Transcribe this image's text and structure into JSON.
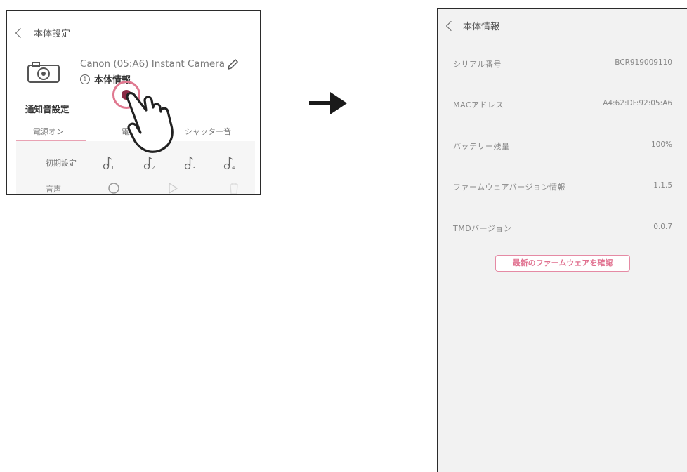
{
  "left_screen": {
    "header": {
      "title": "本体設定"
    },
    "device": {
      "name": "Canon (05:A6) Instant Camera",
      "info_label": "本体情報"
    },
    "notification": {
      "title": "通知音設定"
    },
    "tabs": [
      {
        "label": "電源オン"
      },
      {
        "label": "電源オ"
      },
      {
        "label": "シャッター音"
      }
    ],
    "sound_row": {
      "label": "初期設定",
      "notes": [
        "1",
        "2",
        "3",
        "4"
      ]
    },
    "voice_row": {
      "label": "音声"
    }
  },
  "right_screen": {
    "header": {
      "title": "本体情報"
    },
    "items": [
      {
        "label": "シリアル番号",
        "value": "BCR919009110"
      },
      {
        "label": "MACアドレス",
        "value": "A4:62:DF:92:05:A6"
      },
      {
        "label": "バッテリー残量",
        "value": "100%"
      },
      {
        "label": "ファームウェアバージョン情報",
        "value": "1.1.5"
      },
      {
        "label": "TMDバージョン",
        "value": "0.0.7"
      }
    ],
    "check_button": "最新のファームウェアを確認"
  },
  "colors": {
    "accent": "#e0708f",
    "touch_dot": "#8b2a45",
    "panel_bg": "#f2f2f2"
  },
  "icons": [
    "back-chevron-icon",
    "camera-icon",
    "pencil-icon",
    "info-icon",
    "music-note-icon",
    "circle-icon",
    "play-icon",
    "trash-icon",
    "hand-pointer-icon",
    "arrow-right-icon"
  ]
}
